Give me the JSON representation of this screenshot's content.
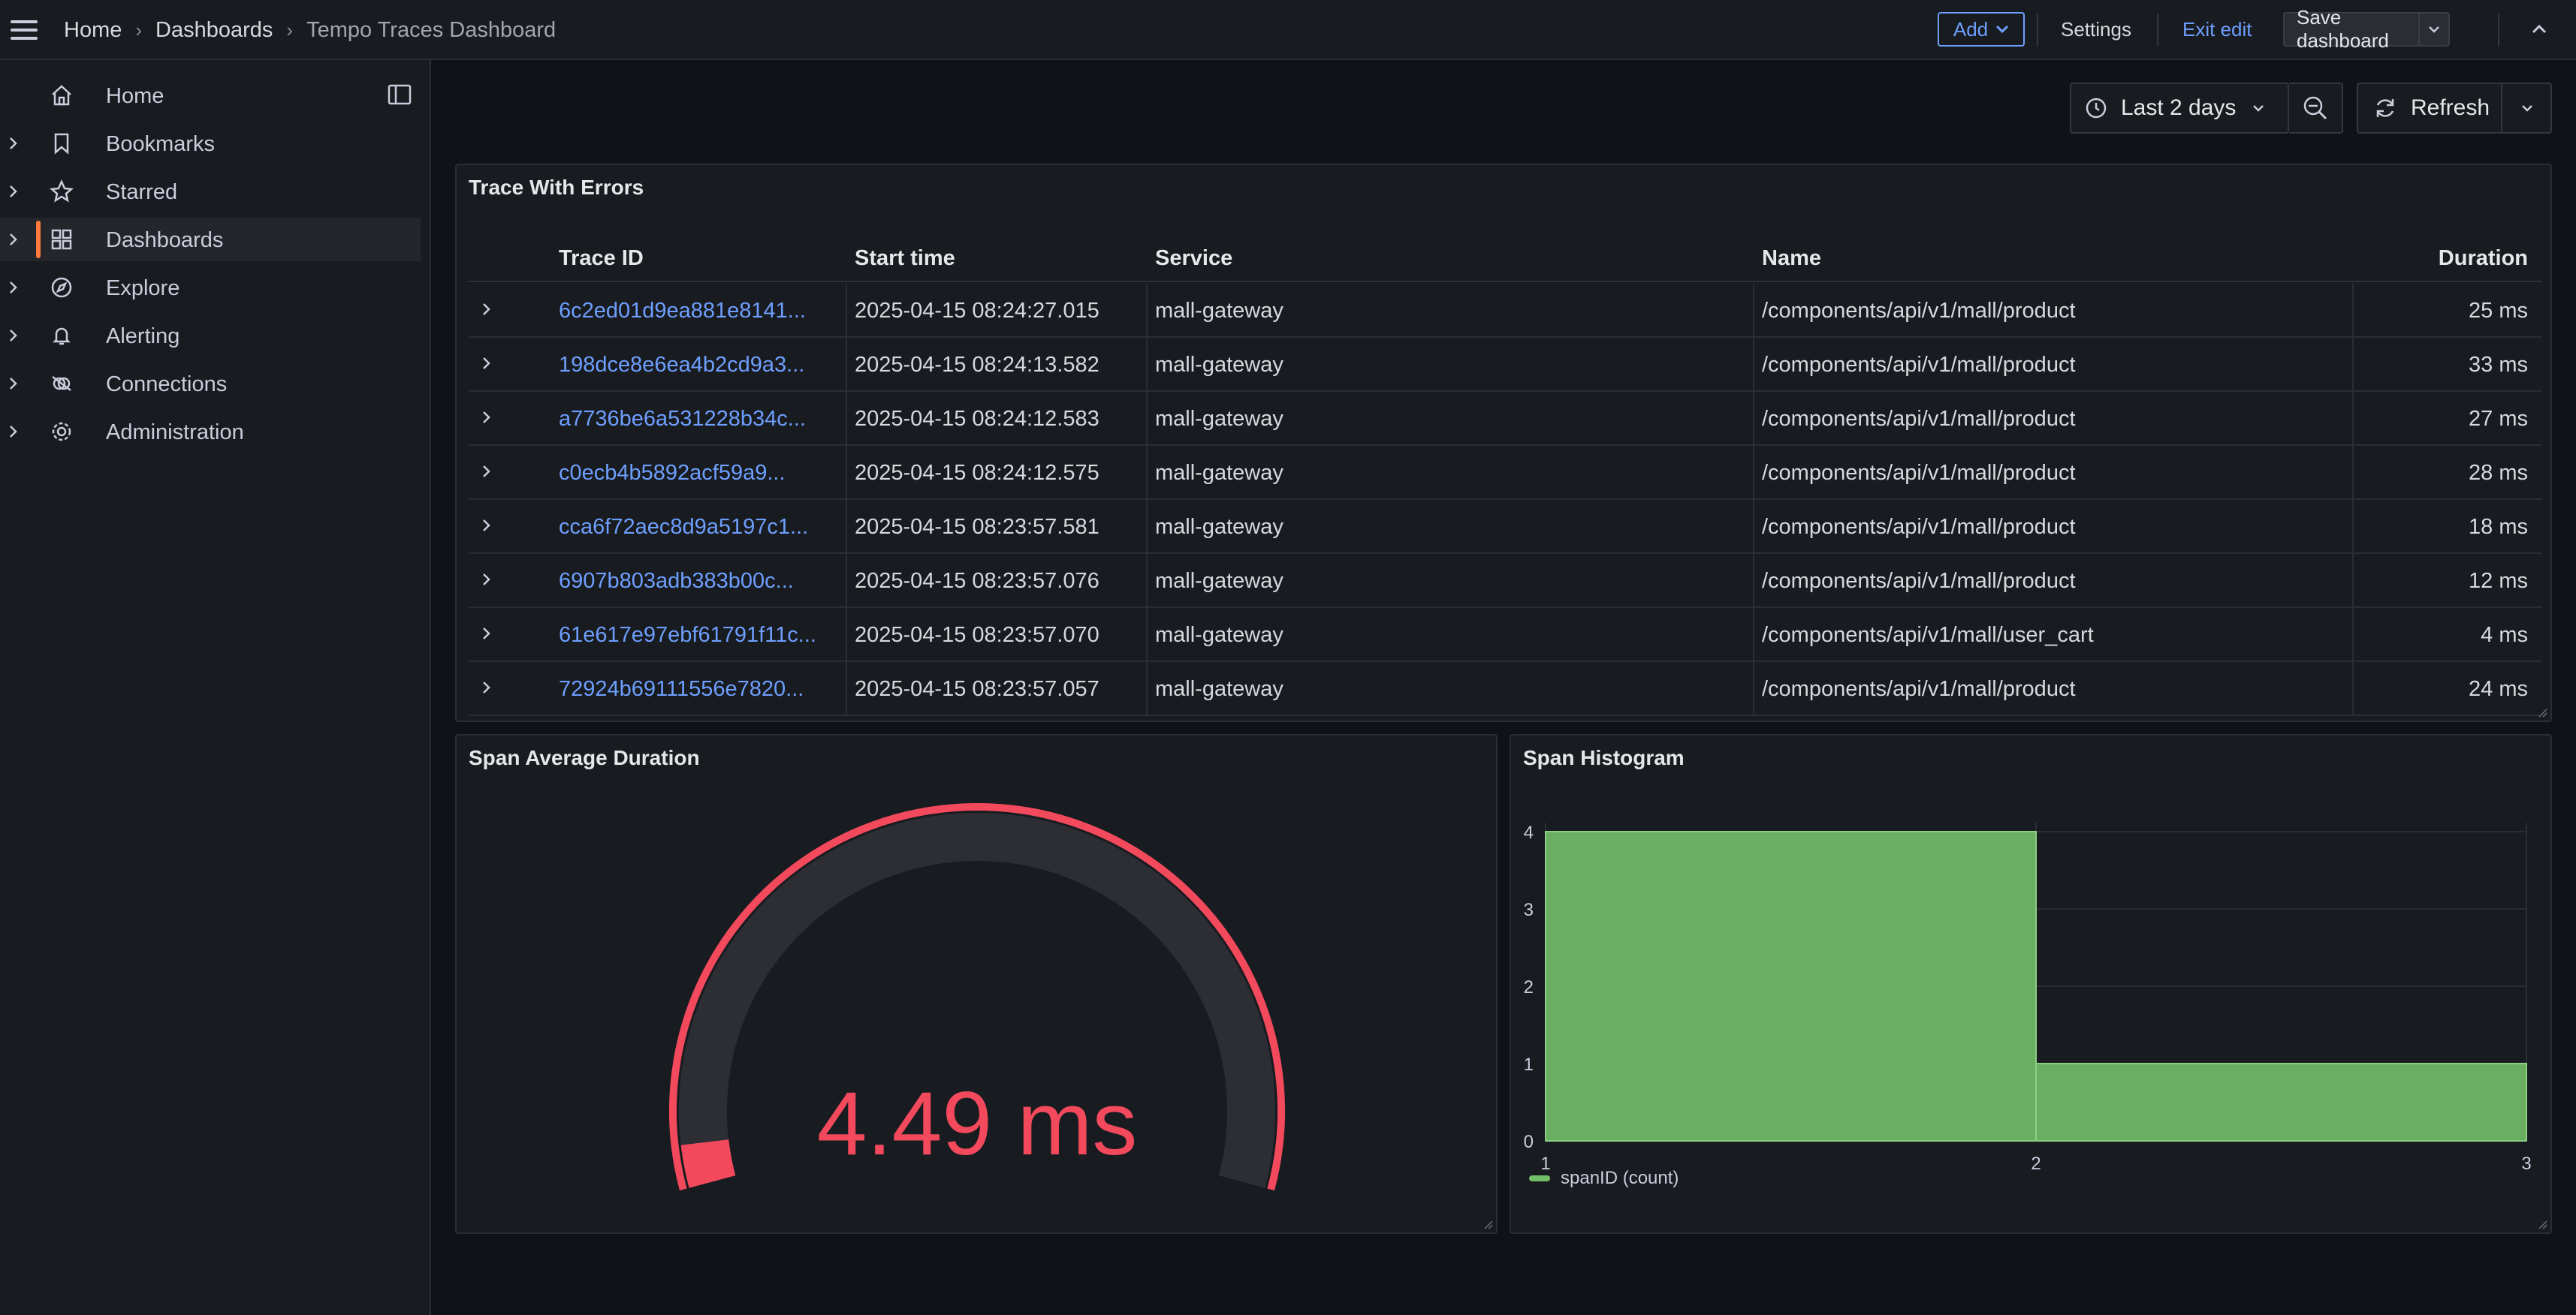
{
  "topbar": {
    "breadcrumb": [
      "Home",
      "Dashboards",
      "Tempo Traces Dashboard"
    ],
    "add_label": "Add",
    "settings_label": "Settings",
    "exit_edit_label": "Exit edit",
    "save_label": "Save dashboard"
  },
  "sidebar": {
    "items": [
      {
        "label": "Home",
        "icon": "home-icon",
        "expandable": false,
        "active": false
      },
      {
        "label": "Bookmarks",
        "icon": "bookmark-icon",
        "expandable": true,
        "active": false
      },
      {
        "label": "Starred",
        "icon": "star-icon",
        "expandable": true,
        "active": false
      },
      {
        "label": "Dashboards",
        "icon": "apps-icon",
        "expandable": true,
        "active": true
      },
      {
        "label": "Explore",
        "icon": "compass-icon",
        "expandable": true,
        "active": false
      },
      {
        "label": "Alerting",
        "icon": "bell-icon",
        "expandable": true,
        "active": false
      },
      {
        "label": "Connections",
        "icon": "plug-icon",
        "expandable": true,
        "active": false
      },
      {
        "label": "Administration",
        "icon": "cog-icon",
        "expandable": true,
        "active": false
      }
    ]
  },
  "controls": {
    "time_range": "Last 2 days",
    "refresh_label": "Refresh"
  },
  "table_panel": {
    "title": "Trace With Errors",
    "columns": [
      "Trace ID",
      "Start time",
      "Service",
      "Name",
      "Duration"
    ],
    "rows": [
      [
        "6c2ed01d9ea881e8141...",
        "2025-04-15 08:24:27.015",
        "mall-gateway",
        "/components/api/v1/mall/product",
        "25 ms"
      ],
      [
        "198dce8e6ea4b2cd9a3...",
        "2025-04-15 08:24:13.582",
        "mall-gateway",
        "/components/api/v1/mall/product",
        "33 ms"
      ],
      [
        "a7736be6a531228b34c...",
        "2025-04-15 08:24:12.583",
        "mall-gateway",
        "/components/api/v1/mall/product",
        "27 ms"
      ],
      [
        "c0ecb4b5892acf59a9...",
        "2025-04-15 08:24:12.575",
        "mall-gateway",
        "/components/api/v1/mall/product",
        "28 ms"
      ],
      [
        "cca6f72aec8d9a5197c1...",
        "2025-04-15 08:23:57.581",
        "mall-gateway",
        "/components/api/v1/mall/product",
        "18 ms"
      ],
      [
        "6907b803adb383b00c...",
        "2025-04-15 08:23:57.076",
        "mall-gateway",
        "/components/api/v1/mall/product",
        "12 ms"
      ],
      [
        "61e617e97ebf61791f11c...",
        "2025-04-15 08:23:57.070",
        "mall-gateway",
        "/components/api/v1/mall/user_cart",
        "4 ms"
      ],
      [
        "72924b69111556e7820...",
        "2025-04-15 08:23:57.057",
        "mall-gateway",
        "/components/api/v1/mall/product",
        "24 ms"
      ]
    ]
  },
  "gauge_panel": {
    "title": "Span Average Duration",
    "value": 4.49,
    "value_text": "4.49 ms",
    "fill_fraction": 0.04,
    "color": "#f2495c"
  },
  "histogram_panel": {
    "title": "Span Histogram",
    "chart_data": {
      "type": "bar",
      "bins": [
        {
          "from": 1,
          "to": 2,
          "count": 4
        },
        {
          "from": 2,
          "to": 3,
          "count": 1
        }
      ],
      "x_ticks": [
        "1",
        "2",
        "3"
      ],
      "y_ticks": [
        "0",
        "1",
        "2",
        "3",
        "4"
      ],
      "ylim": [
        0,
        4
      ],
      "xlim": [
        1,
        3
      ],
      "legend": "spanID (count)",
      "legend_position": "bottom-left",
      "color": "#73bf69"
    }
  }
}
